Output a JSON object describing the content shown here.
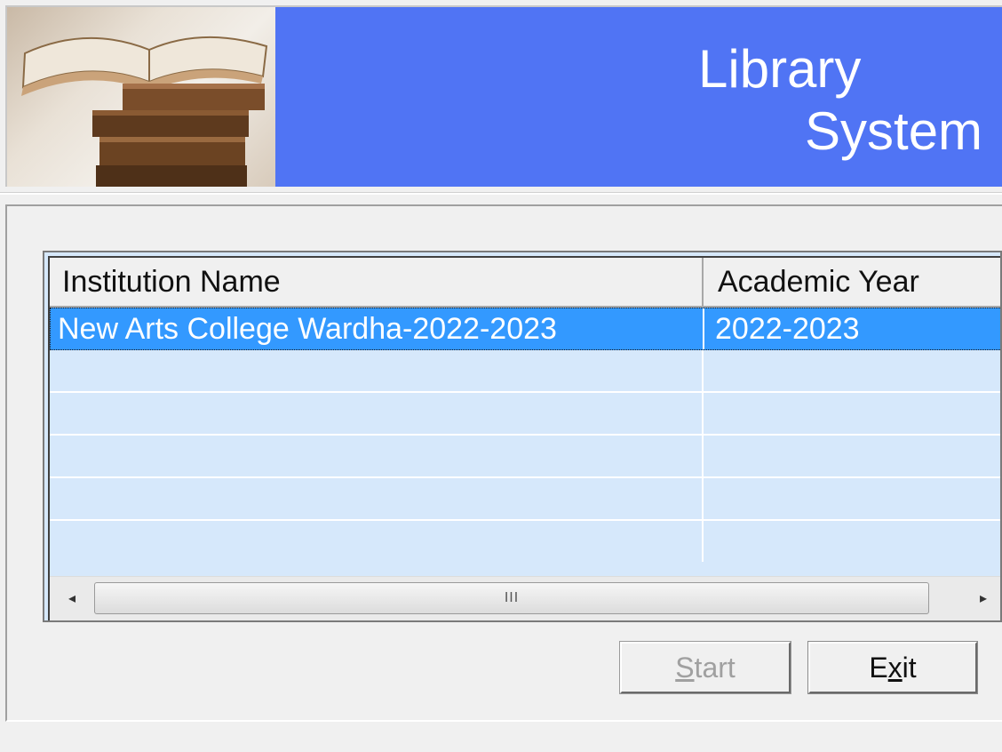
{
  "window": {
    "banner": {
      "title_line1": "Library",
      "title_line2": "System",
      "banner_color": "#5074f4",
      "image": "books-stack-photo"
    }
  },
  "list": {
    "columns": [
      {
        "label": "Institution Name"
      },
      {
        "label": "Academic Year"
      }
    ],
    "rows": [
      {
        "institution": "New Arts College Wardha-2022-2023",
        "year": "2022-2023",
        "selected": true
      }
    ],
    "selection_color": "#3399ff",
    "background_color": "#d6e8fb",
    "scrollbar": {
      "left_arrow": "◂",
      "right_arrow": "▸",
      "grip": "III"
    }
  },
  "buttons": {
    "start": {
      "mnemonic": "S",
      "rest": "tart",
      "enabled": false
    },
    "exit": {
      "pre": "E",
      "mnemonic": "x",
      "rest": "it",
      "enabled": true
    }
  }
}
